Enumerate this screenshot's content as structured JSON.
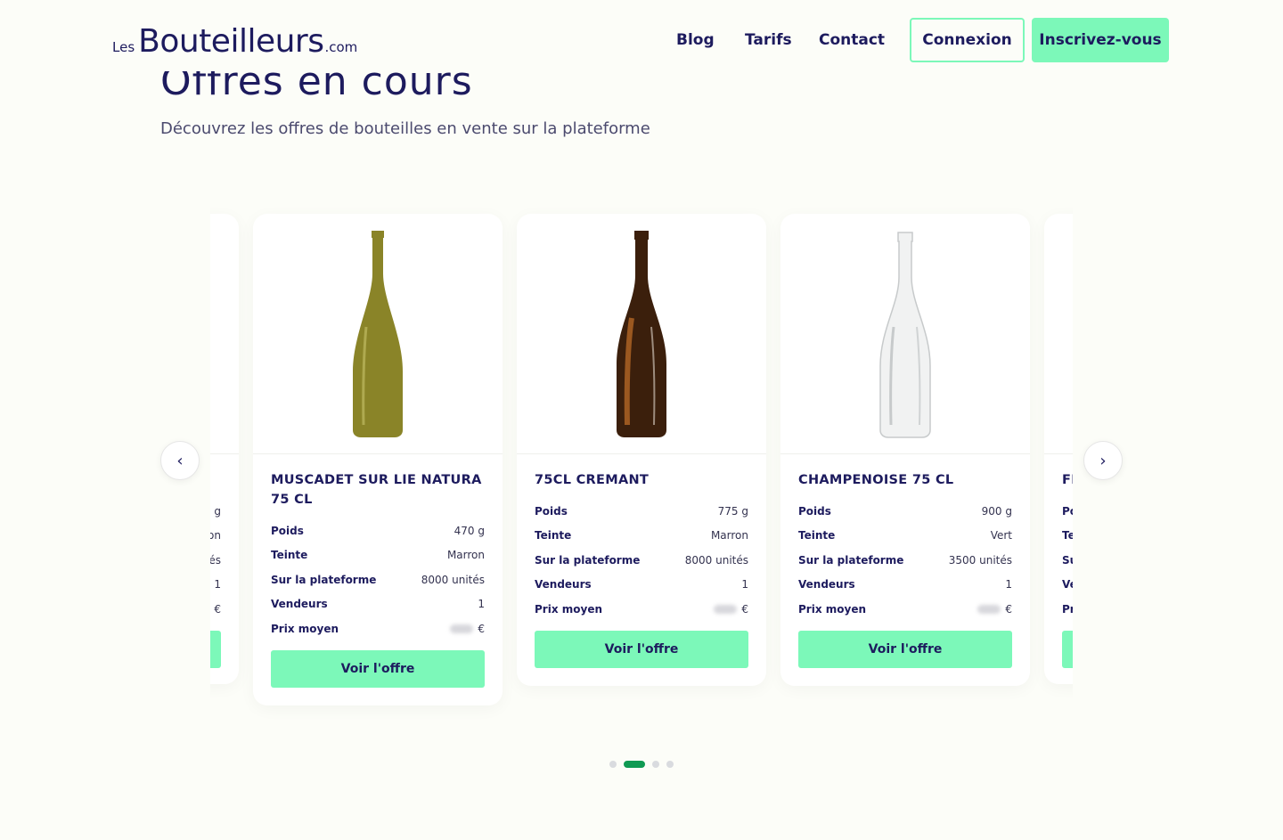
{
  "header": {
    "logo": {
      "prefix": "Les",
      "main": "Bouteilleurs",
      "suffix": ".com"
    },
    "nav": [
      "Blog",
      "Tarifs",
      "Contact"
    ],
    "login": "Connexion",
    "signup": "Inscrivez-vous"
  },
  "section": {
    "title": "Offres en cours",
    "subtitle": "Découvrez les offres de bouteilles en vente sur la plateforme"
  },
  "labels": {
    "poids": "Poids",
    "teinte": "Teinte",
    "plateforme": "Sur la plateforme",
    "vendeurs": "Vendeurs",
    "prix": "Prix moyen",
    "currency": "€",
    "cta": "Voir l'offre"
  },
  "cards": [
    {
      "name": "",
      "poids": "g",
      "teinte": "on",
      "plateforme": "és",
      "vendeurs": "1"
    },
    {
      "name": "MUSCADET SUR LIE NATURA 75 CL",
      "poids": "470 g",
      "teinte": "Marron",
      "plateforme": "8000 unités",
      "vendeurs": "1",
      "bottle_color": "#8a8428"
    },
    {
      "name": "75CL CREMANT",
      "poids": "775 g",
      "teinte": "Marron",
      "plateforme": "8000 unités",
      "vendeurs": "1",
      "bottle_color": "#3b1f0c"
    },
    {
      "name": "CHAMPENOISE 75 CL",
      "poids": "900 g",
      "teinte": "Vert",
      "plateforme": "3500 unités",
      "vendeurs": "1",
      "bottle_color": "#e4e6e6"
    },
    {
      "name": "FI",
      "poids": "",
      "teinte": "",
      "plateforme": "",
      "vendeurs": ""
    }
  ],
  "arrows": {
    "prev": "‹",
    "next": "›"
  },
  "pagination": {
    "pages": 4,
    "active": 2
  },
  "colors": {
    "accent": "#7cf8b9",
    "brand": "#1d1b5e",
    "dot_active": "#0f9a53"
  }
}
